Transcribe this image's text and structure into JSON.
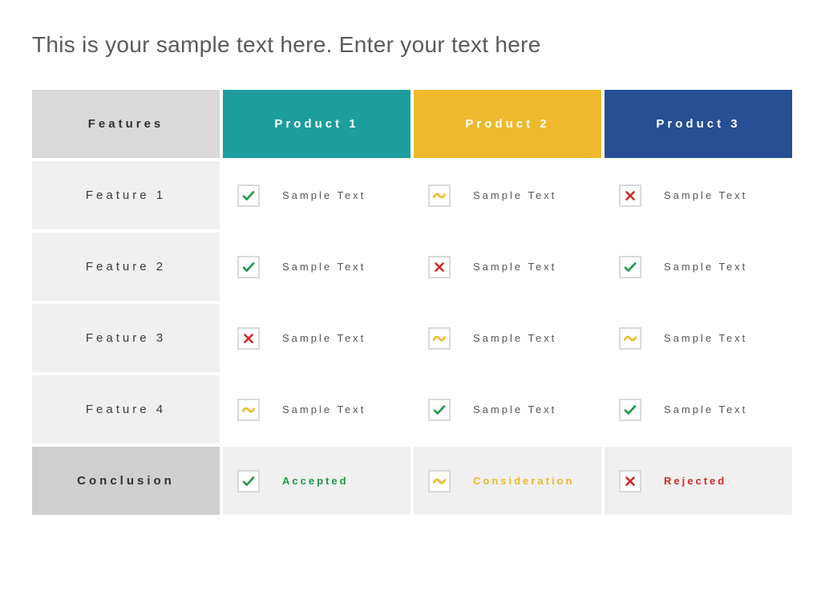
{
  "title": "This is your sample text here. Enter your text here",
  "headers": {
    "features": "Features",
    "products": [
      "Product 1",
      "Product 2",
      "Product 3"
    ]
  },
  "colors": {
    "product1": "#1e9d9d",
    "product2": "#eeb92c",
    "product3": "#264f94"
  },
  "status_types": {
    "check": "Accepted",
    "tilde": "Consideration",
    "cross": "Rejected"
  },
  "rows": [
    {
      "label": "Feature 1",
      "cells": [
        {
          "status": "check",
          "text": "Sample Text"
        },
        {
          "status": "tilde",
          "text": "Sample Text"
        },
        {
          "status": "cross",
          "text": "Sample Text"
        }
      ]
    },
    {
      "label": "Feature 2",
      "cells": [
        {
          "status": "check",
          "text": "Sample Text"
        },
        {
          "status": "cross",
          "text": "Sample Text"
        },
        {
          "status": "check",
          "text": "Sample Text"
        }
      ]
    },
    {
      "label": "Feature 3",
      "cells": [
        {
          "status": "cross",
          "text": "Sample Text"
        },
        {
          "status": "tilde",
          "text": "Sample Text"
        },
        {
          "status": "tilde",
          "text": "Sample Text"
        }
      ]
    },
    {
      "label": "Feature 4",
      "cells": [
        {
          "status": "tilde",
          "text": "Sample Text"
        },
        {
          "status": "check",
          "text": "Sample Text"
        },
        {
          "status": "check",
          "text": "Sample Text"
        }
      ]
    }
  ],
  "conclusion": {
    "label": "Conclusion",
    "cells": [
      {
        "status": "check",
        "text": "Accepted",
        "class": "accepted"
      },
      {
        "status": "tilde",
        "text": "Consideration",
        "class": "consideration"
      },
      {
        "status": "cross",
        "text": "Rejected",
        "class": "rejected"
      }
    ]
  }
}
